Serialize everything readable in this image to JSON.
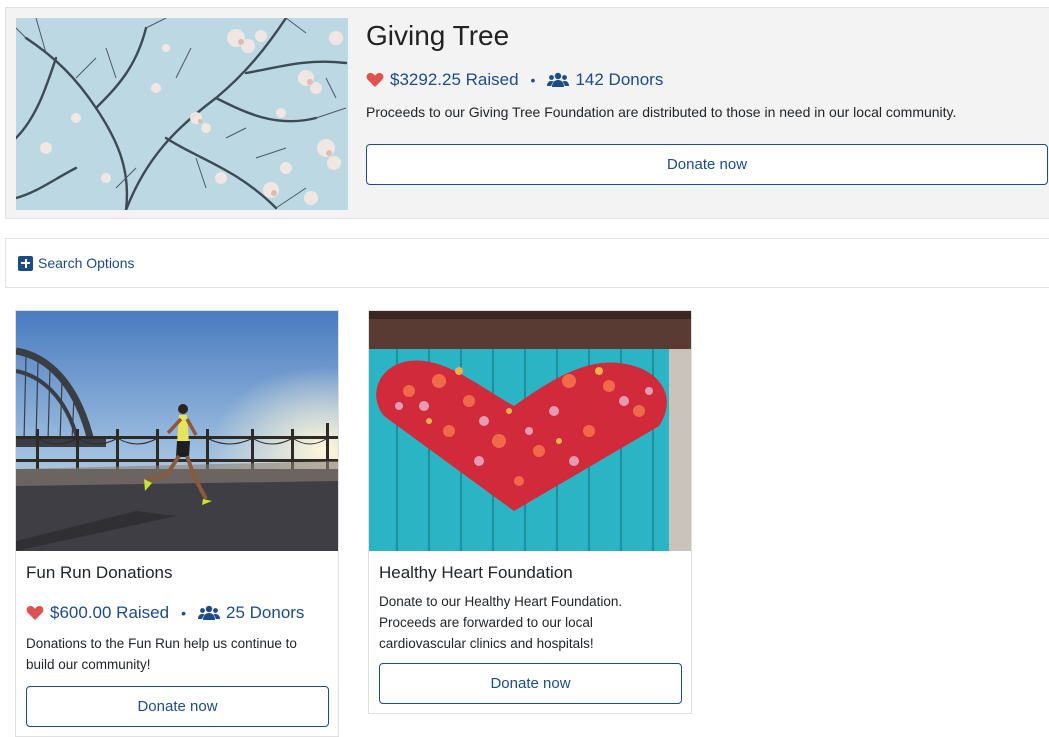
{
  "featured": {
    "title": "Giving Tree",
    "raised": "$3292.25 Raised",
    "separator": "•",
    "donors": "142 Donors",
    "description": "Proceeds to our Giving Tree Foundation are distributed to those in need in our local community.",
    "donate_label": "Donate now"
  },
  "search": {
    "label": "Search Options"
  },
  "cards": [
    {
      "title": "Fun Run Donations",
      "raised": "$600.00 Raised",
      "separator": "•",
      "donors": "25 Donors",
      "description": "Donations to the Fun Run help us continue to build our community!",
      "donate_label": "Donate now"
    },
    {
      "title": "Healthy Heart Foundation",
      "description": "Donate to our Healthy Heart Foundation. Proceeds are forwarded to our local cardiovascular clinics and hospitals!",
      "donate_label": "Donate now"
    }
  ],
  "colors": {
    "accent": "#1d4b87",
    "heart": "#e05252",
    "panel_bg": "#f3f3f3"
  },
  "icons": {
    "heart": "heart-icon",
    "donors": "users-icon",
    "search_toggle": "plus-square-icon"
  }
}
